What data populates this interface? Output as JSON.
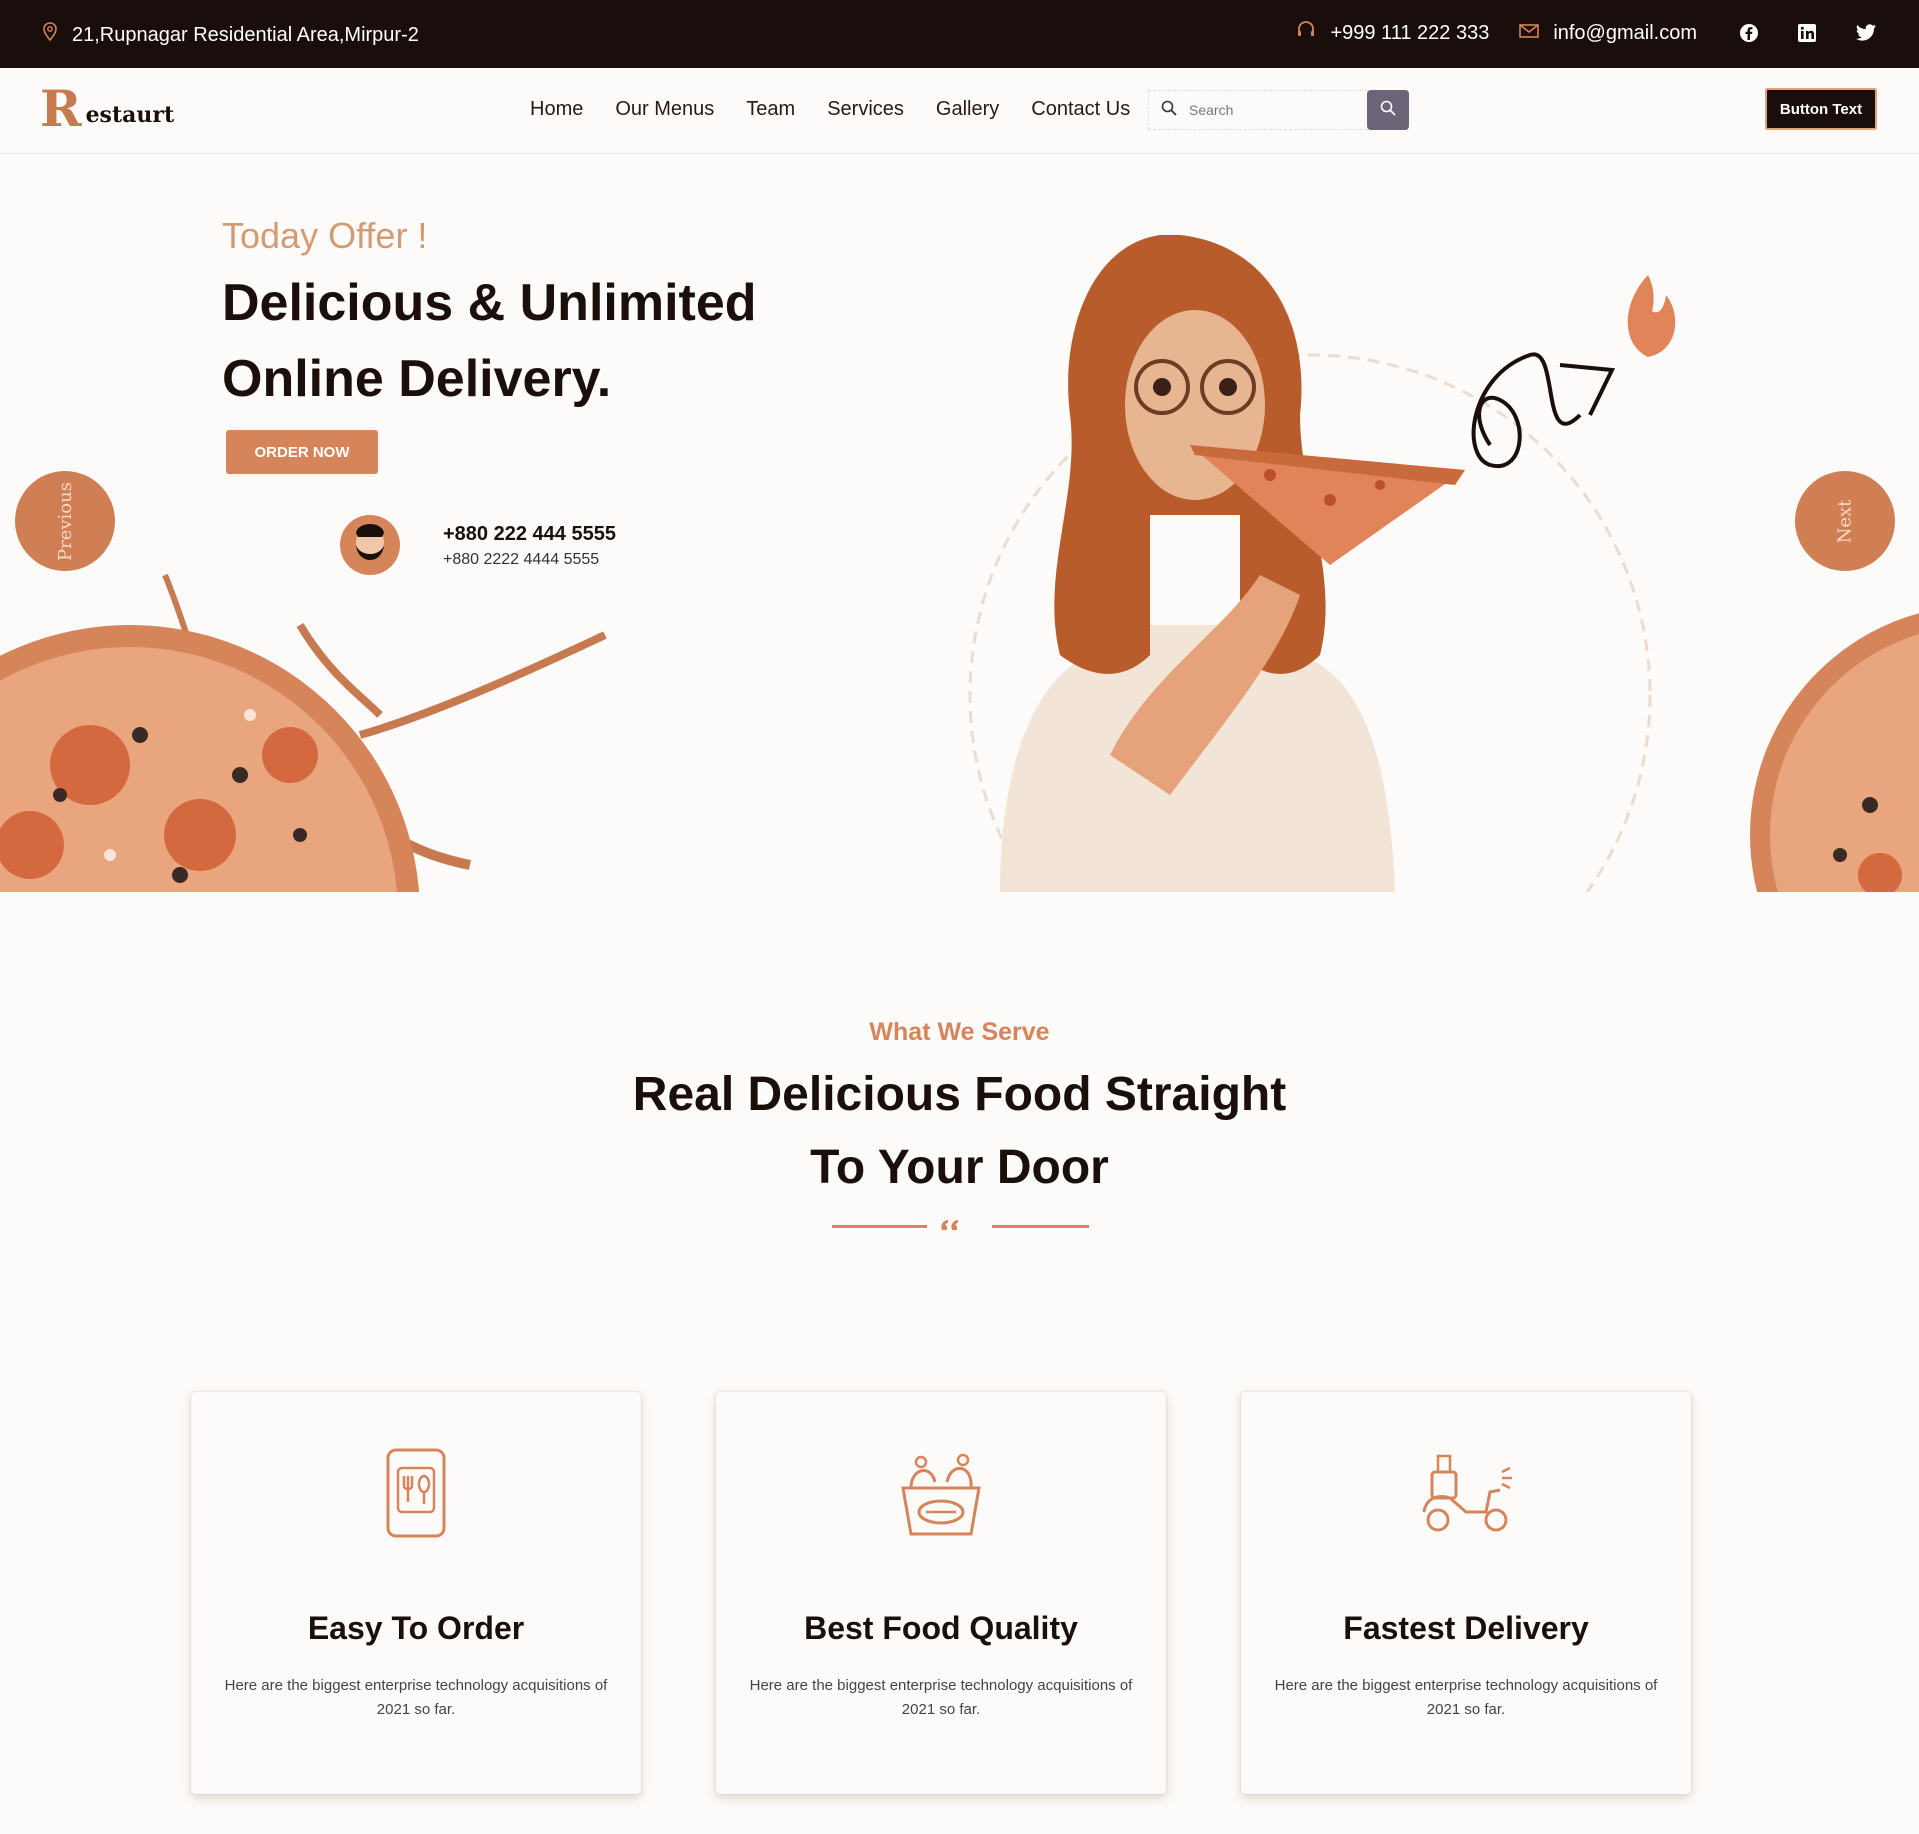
{
  "topbar": {
    "address": "21,Rupnagar Residential Area,Mirpur-2",
    "phone": "+999 111 222 333",
    "email": "info@gmail.com",
    "social_icons": [
      "facebook-icon",
      "linkedin-icon",
      "twitter-icon"
    ]
  },
  "nav": {
    "logo_letter": "R",
    "logo_rest": "estaurt",
    "menu": [
      "Home",
      "Our Menus",
      "Team",
      "Services",
      "Gallery",
      "Contact Us"
    ],
    "search_placeholder": "Search",
    "button_label": "Button Text"
  },
  "hero": {
    "offer": "Today Offer !",
    "headline_line1": "Delicious & Unlimited",
    "headline_line2": "Online Delivery.",
    "order_label": "ORDER NOW",
    "phone_primary": "+880 222 444 5555",
    "phone_secondary": "+880 2222 4444 5555",
    "prev_label": "Previous",
    "next_label": "Next"
  },
  "serve": {
    "subtitle": "What We Serve",
    "title_line1": "Real Delicious Food Straight",
    "title_line2": "To Your Door",
    "cards": [
      {
        "icon": "phone-order-icon",
        "title": "Easy To Order",
        "desc": "Here are the biggest enterprise technology acquisitions of 2021 so far."
      },
      {
        "icon": "food-basket-icon",
        "title": "Best Food Quality",
        "desc": "Here are the biggest enterprise technology acquisitions of 2021 so far."
      },
      {
        "icon": "delivery-scooter-icon",
        "title": "Fastest Delivery",
        "desc": "Here are the biggest enterprise technology acquisitions of 2021 so far."
      }
    ]
  },
  "colors": {
    "accent": "#d6845a",
    "dark": "#1a0e0c",
    "background": "#fcfbf9"
  }
}
